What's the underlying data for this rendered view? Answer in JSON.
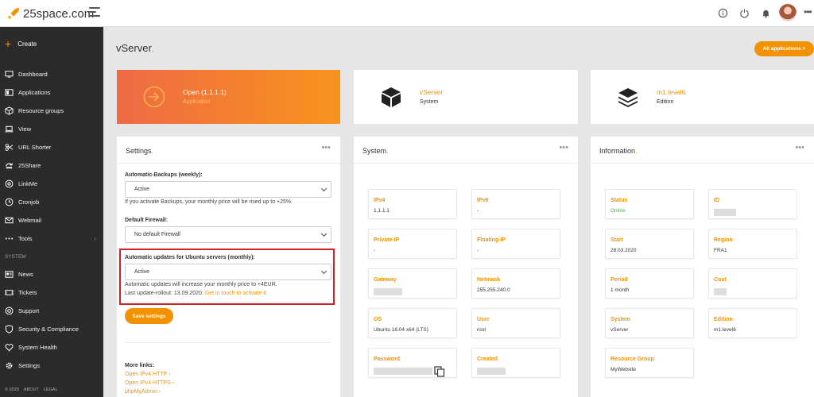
{
  "brand": {
    "name": "25space.com"
  },
  "header": {
    "icons": [
      "info-icon",
      "power-icon",
      "bell-icon",
      "avatar",
      "more-icon"
    ]
  },
  "sidebar": {
    "create": "Create",
    "items": [
      {
        "label": "Dashboard",
        "icon": "monitor-icon"
      },
      {
        "label": "Applications",
        "icon": "applications-icon"
      },
      {
        "label": "Resource groups",
        "icon": "cube-icon"
      },
      {
        "label": "View",
        "icon": "laptop-icon"
      },
      {
        "label": "URL Shorter",
        "icon": "scissors-icon"
      },
      {
        "label": "25Share",
        "icon": "share-icon"
      },
      {
        "label": "LinkMe",
        "icon": "at-icon"
      },
      {
        "label": "Cronjob",
        "icon": "clock-icon"
      },
      {
        "label": "Webmail",
        "icon": "mail-icon"
      },
      {
        "label": "Tools",
        "icon": "dots-icon"
      }
    ],
    "system_label": "SYSTEM",
    "system_items": [
      {
        "label": "News",
        "icon": "news-icon"
      },
      {
        "label": "Tickets",
        "icon": "ticket-icon"
      },
      {
        "label": "Support",
        "icon": "support-icon"
      },
      {
        "label": "Security & Compliance",
        "icon": "shield-icon"
      },
      {
        "label": "System Health",
        "icon": "heart-icon"
      },
      {
        "label": "Settings",
        "icon": "gear-icon"
      }
    ],
    "footer": [
      "© 2020",
      "ABOUT",
      "LEGAL"
    ]
  },
  "page": {
    "title": "vServer",
    "all_apps_label": "All applications >"
  },
  "header_cards": [
    {
      "title": "Open (1.1.1.1)",
      "subtitle": "Application"
    },
    {
      "title": "vServer",
      "subtitle": "System"
    },
    {
      "title": "m1.level6",
      "subtitle": "Edition"
    }
  ],
  "settings": {
    "title": "Settings",
    "backups_label": "Automatic-Backups (weekly):",
    "backups_value": "Active",
    "backups_note": "If you activate Backups, your monthly price will be rised up to +25%.",
    "firewall_label": "Default Firewall:",
    "firewall_value": "No default Firewall",
    "updates_label": "Automatic updates for Ubuntu servers (monthly):",
    "updates_value": "Active",
    "updates_note": "Automatic updates will increase your monthly price to +4EUR.",
    "rollout_text": "Last update-rollout: 13.09.2020.",
    "rollout_link": "Get in touch to activate it.",
    "save_label": "Save settings",
    "more_links_label": "More links:",
    "links": [
      "Open IPv4 HTTP",
      "Open IPv4 HTTPS",
      "phpMyAdmin"
    ]
  },
  "system": {
    "title": "System",
    "fields": [
      {
        "label": "IPv4",
        "value": "1.1.1.1"
      },
      {
        "label": "IPv6",
        "value": "-"
      },
      {
        "label": "Private-IP",
        "value": "-"
      },
      {
        "label": "Floating-IP",
        "value": "-"
      },
      {
        "label": "Gateway",
        "value": ""
      },
      {
        "label": "Netmask",
        "value": "255.255.240.0"
      },
      {
        "label": "OS",
        "value": "Ubuntu 18.04 x64 (LTS)"
      },
      {
        "label": "User",
        "value": "root"
      },
      {
        "label": "Password",
        "value": ""
      },
      {
        "label": "Created",
        "value": ""
      }
    ]
  },
  "information": {
    "title": "Information",
    "fields": [
      {
        "label": "Status",
        "value": "Online"
      },
      {
        "label": "ID",
        "value": ""
      },
      {
        "label": "Start",
        "value": "28.03.2020"
      },
      {
        "label": "Region",
        "value": "FRA1"
      },
      {
        "label": "Period",
        "value": "1 month"
      },
      {
        "label": "Cost",
        "value": ""
      },
      {
        "label": "System",
        "value": "vServer"
      },
      {
        "label": "Edition",
        "value": "m1.level6"
      },
      {
        "label": "Resource Group",
        "value": "MyWebsite"
      }
    ]
  },
  "colors": {
    "accent": "#f39200",
    "sidebar": "#2b2b2b",
    "highlight": "#d32027",
    "online": "#4caf50"
  }
}
